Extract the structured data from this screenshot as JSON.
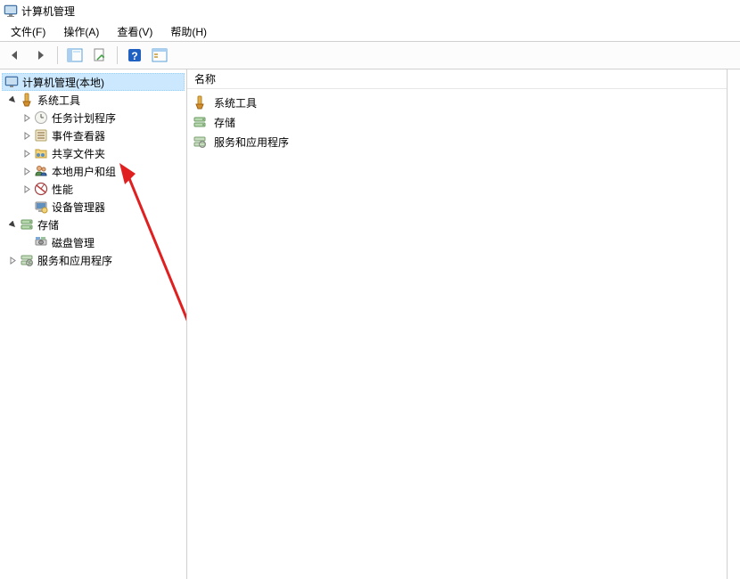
{
  "window": {
    "title": "计算机管理"
  },
  "menu": {
    "file": "文件(F)",
    "action": "操作(A)",
    "view": "查看(V)",
    "help": "帮助(H)"
  },
  "tree": {
    "root": {
      "label": "计算机管理(本地)"
    },
    "system_tools": {
      "label": "系统工具",
      "children": {
        "task_scheduler": "任务计划程序",
        "event_viewer": "事件查看器",
        "shared_folders": "共享文件夹",
        "local_users_groups": "本地用户和组",
        "performance": "性能",
        "device_manager": "设备管理器"
      }
    },
    "storage": {
      "label": "存储",
      "children": {
        "disk_mgmt": "磁盘管理"
      }
    },
    "services_apps": {
      "label": "服务和应用程序"
    }
  },
  "list": {
    "header": "名称",
    "items": {
      "system_tools": "系统工具",
      "storage": "存储",
      "services_apps": "服务和应用程序"
    }
  }
}
